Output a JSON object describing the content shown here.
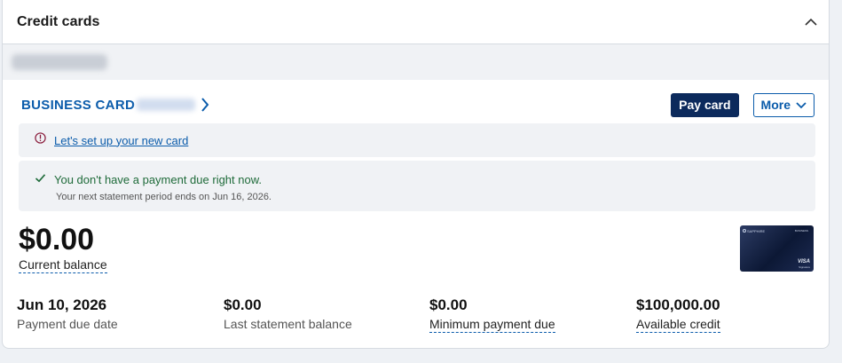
{
  "panel": {
    "title": "Credit cards",
    "collapse_icon": "chevron-up-icon"
  },
  "card": {
    "name": "BUSINESS CARD",
    "pay_label": "Pay card",
    "more_label": "More"
  },
  "notices": {
    "setup_link": "Let's set up your new card",
    "payment_status": "You don't have a payment due right now.",
    "statement_note": "Your next statement period ends on Jun 16, 2026."
  },
  "balance": {
    "amount": "$0.00",
    "label": "Current balance"
  },
  "card_image": {
    "brand": "SAPPHIRE",
    "tag": "BUSINESS",
    "network": "VISA",
    "network_sub": "Signature"
  },
  "stats": [
    {
      "value": "Jun 10, 2026",
      "label": "Payment due date"
    },
    {
      "value": "$0.00",
      "label": "Last statement balance"
    },
    {
      "value": "$0.00",
      "label": "Minimum payment due"
    },
    {
      "value": "$100,000.00",
      "label": "Available credit"
    }
  ],
  "colors": {
    "accent": "#0b5cab",
    "primary_button": "#0c2a5c",
    "success": "#1f6b3a",
    "info_icon": "#8a1c3c",
    "notice_bg": "#f0f2f5"
  }
}
